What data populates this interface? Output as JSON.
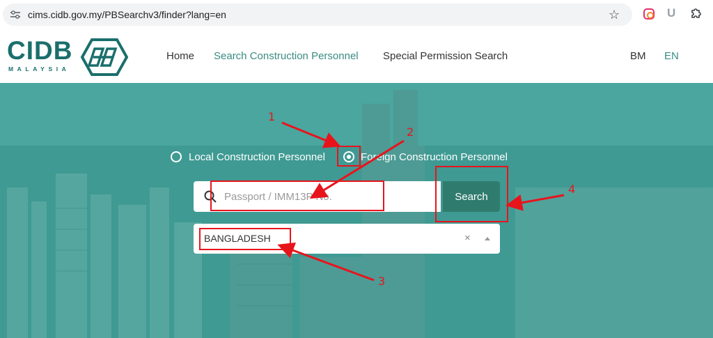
{
  "browser": {
    "url": "cims.cidb.gov.my/PBSearchv3/finder?lang=en",
    "extensions": [
      "instagram-extension-icon",
      "u-extension-icon",
      "puzzle-icon"
    ]
  },
  "header": {
    "logo_text": "CIDB",
    "logo_sub": "MALAYSIA",
    "nav": [
      "Home",
      "Search Construction Personnel",
      "Special Permission Search"
    ],
    "languages": [
      "BM",
      "EN"
    ],
    "active_nav": "Search Construction Personnel",
    "active_language": "EN"
  },
  "search": {
    "options": [
      "Local Construction Personnel",
      "Foreign Construction Personnel"
    ],
    "selected_option": "Foreign Construction Personnel",
    "placeholder": "Passport / IMM13P No.",
    "button_label": "Search",
    "country_value": "BANGLADESH",
    "clear_symbol": "×"
  },
  "annotations": {
    "numbers": [
      "1",
      "2",
      "3",
      "4"
    ],
    "color": "#e8141c"
  },
  "colors": {
    "brand": "#1a6f6c",
    "accent": "#3a8c80",
    "search_button": "#2f7c6e",
    "hero": "#3f9a93"
  }
}
